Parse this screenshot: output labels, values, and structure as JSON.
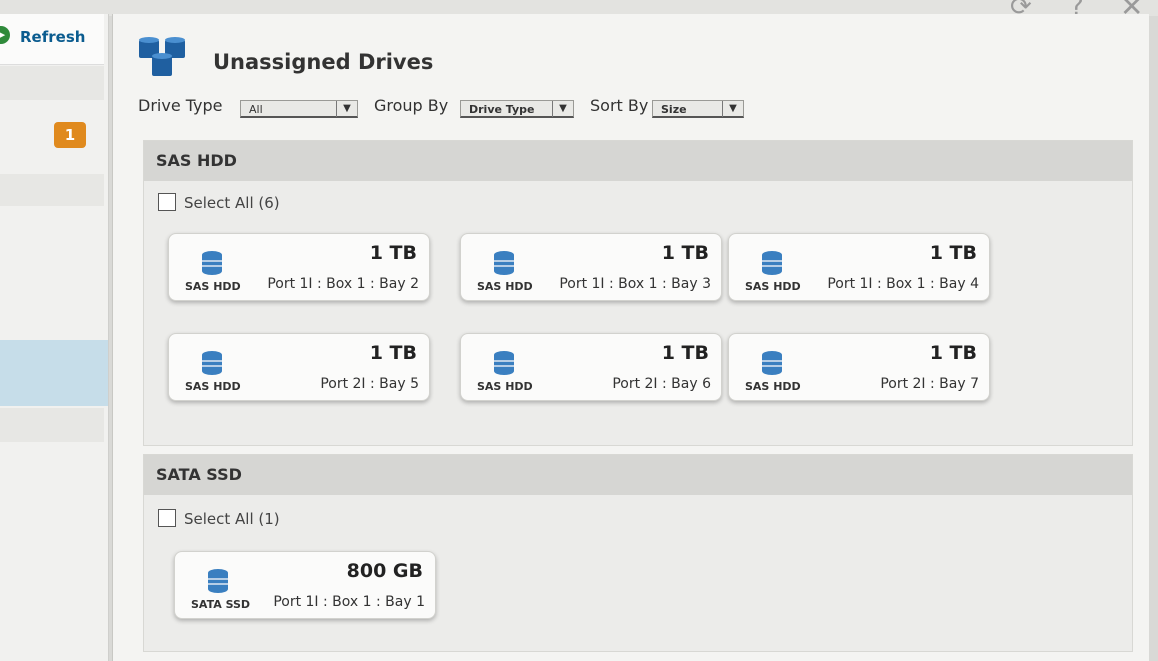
{
  "sidebar": {
    "refresh_label": "Refresh",
    "badge_count": "1"
  },
  "panel": {
    "title": "Unassigned Drives"
  },
  "filters": {
    "drive_type_label": "Drive Type",
    "drive_type_value": "All",
    "group_by_label": "Group By",
    "group_by_value": "Drive Type",
    "sort_by_label": "Sort By",
    "sort_by_value": "Size"
  },
  "groups": [
    {
      "name": "SAS HDD",
      "select_all": "Select All (6)",
      "drives": [
        {
          "type": "SAS HDD",
          "size": "1 TB",
          "location": "Port 1I : Box 1 : Bay 2"
        },
        {
          "type": "SAS HDD",
          "size": "1 TB",
          "location": "Port 1I : Box 1 : Bay 3"
        },
        {
          "type": "SAS HDD",
          "size": "1 TB",
          "location": "Port 1I : Box 1 : Bay 4"
        },
        {
          "type": "SAS HDD",
          "size": "1 TB",
          "location": "Port 2I : Bay 5"
        },
        {
          "type": "SAS HDD",
          "size": "1 TB",
          "location": "Port 2I : Bay 6"
        },
        {
          "type": "SAS HDD",
          "size": "1 TB",
          "location": "Port 2I : Bay 7"
        }
      ]
    },
    {
      "name": "SATA SSD",
      "select_all": "Select All (1)",
      "drives": [
        {
          "type": "SATA SSD",
          "size": "800 GB",
          "location": "Port 1I : Box 1 : Bay 1"
        }
      ]
    }
  ],
  "colors": {
    "accent_blue": "#0b5c8f",
    "badge_orange": "#e08a1e",
    "drive_icon_blue": "#3a7fc0",
    "refresh_green": "#2f8a3a"
  }
}
